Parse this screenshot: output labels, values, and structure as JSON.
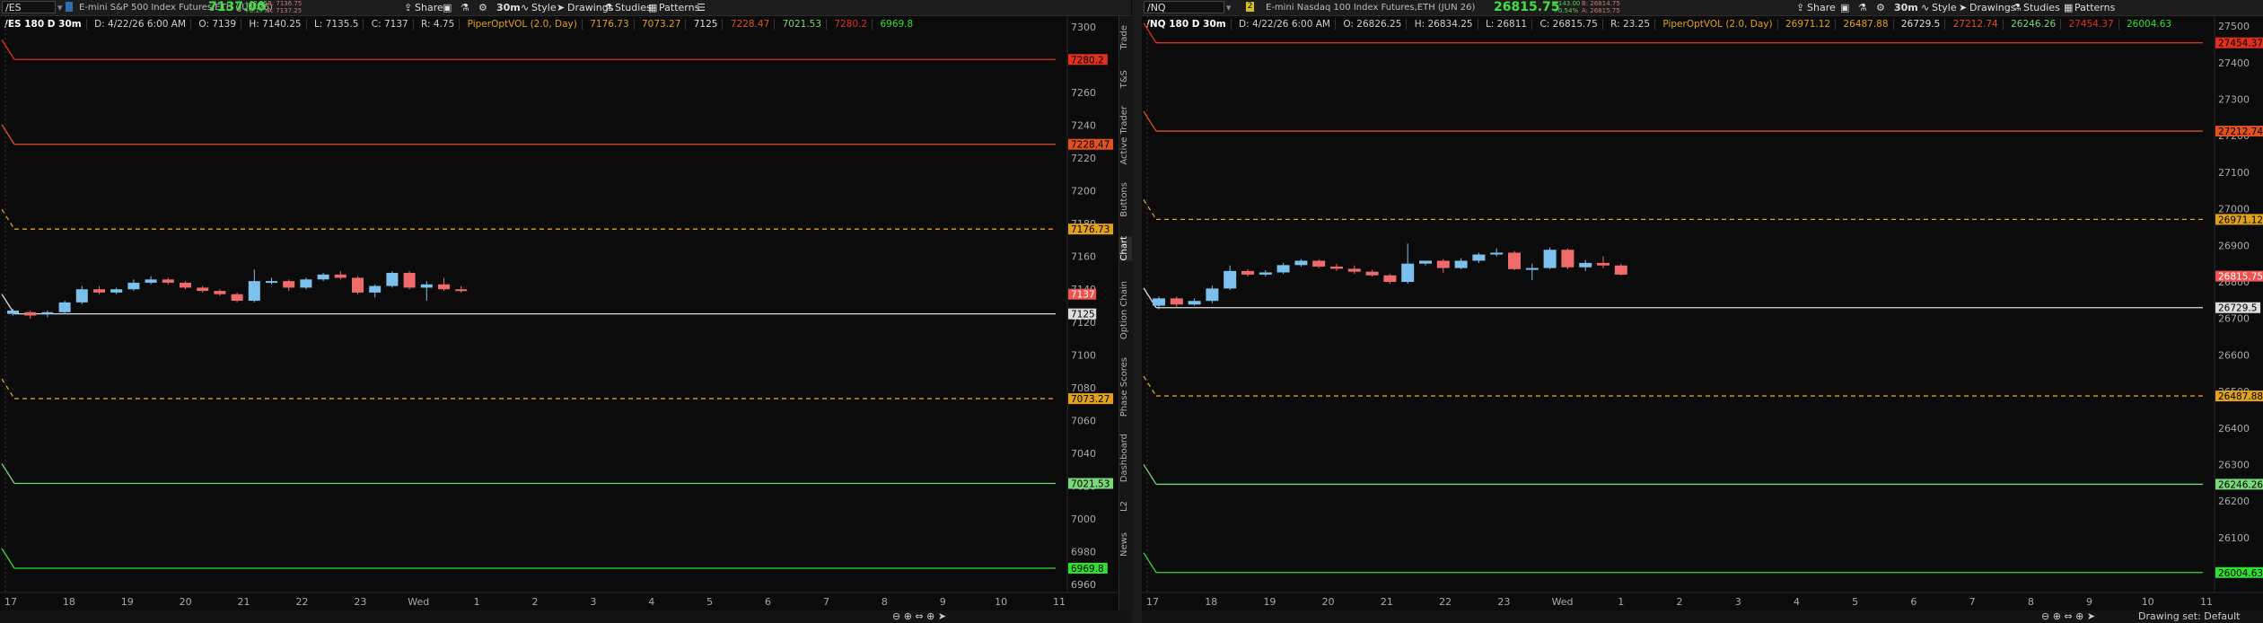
{
  "left": {
    "symbol": "/ES",
    "description": "E-mini S&P 500 Index Futures,ETH (JUN 26)",
    "last_price": "7137.00",
    "change": "+12.25",
    "change_pct": "+0.17%",
    "bid": "B: 7136.75",
    "ask": "A: 7137.25",
    "interval": "30m",
    "toolbar": {
      "share": "Share",
      "style": "Style",
      "drawings": "Drawings",
      "studies": "Studies",
      "patterns": "Patterns"
    },
    "info": {
      "title": "/ES 180 D 30m",
      "date": "D: 4/22/26 6:00 AM",
      "open": "O: 7139",
      "high": "H: 7140.25",
      "low": "L: 7135.5",
      "close": "C: 7137",
      "range": "R: 4.75",
      "study": "PiperOptVOL (2.0, Day)",
      "levels": [
        "7176.73",
        "7073.27",
        "7125",
        "7228.47",
        "7021.53",
        "7280.2",
        "6969.8"
      ]
    },
    "chart_data": {
      "type": "candlestick",
      "ylim": [
        6955,
        7305
      ],
      "y_ticks": [
        6960,
        6980,
        7000,
        7020,
        7040,
        7060,
        7080,
        7100,
        7120,
        7140,
        7160,
        7180,
        7200,
        7220,
        7240,
        7260,
        7280,
        7300
      ],
      "x_ticks": [
        "17",
        "18",
        "19",
        "20",
        "21",
        "22",
        "23",
        "Wed",
        "1",
        "2",
        "3",
        "4",
        "5",
        "6",
        "7",
        "8",
        "9",
        "10",
        "11"
      ],
      "candles": [
        {
          "o": 7125,
          "h": 7128,
          "c": 7127,
          "l": 7124
        },
        {
          "o": 7126,
          "h": 7127,
          "c": 7124,
          "l": 7122
        },
        {
          "o": 7125,
          "h": 7127,
          "c": 7126,
          "l": 7123
        },
        {
          "o": 7126,
          "h": 7133,
          "c": 7132,
          "l": 7125
        },
        {
          "o": 7132,
          "h": 7142,
          "c": 7140,
          "l": 7131
        },
        {
          "o": 7140,
          "h": 7142,
          "c": 7138,
          "l": 7137
        },
        {
          "o": 7138,
          "h": 7141,
          "c": 7140,
          "l": 7137
        },
        {
          "o": 7140,
          "h": 7146,
          "c": 7144,
          "l": 7139
        },
        {
          "o": 7144,
          "h": 7148,
          "c": 7146,
          "l": 7143
        },
        {
          "o": 7146,
          "h": 7147,
          "c": 7144,
          "l": 7143
        },
        {
          "o": 7144,
          "h": 7145,
          "c": 7141,
          "l": 7140
        },
        {
          "o": 7141,
          "h": 7142,
          "c": 7139,
          "l": 7138
        },
        {
          "o": 7139,
          "h": 7140,
          "c": 7137,
          "l": 7136
        },
        {
          "o": 7137,
          "h": 7138,
          "c": 7133,
          "l": 7132
        },
        {
          "o": 7133,
          "h": 7152,
          "c": 7145,
          "l": 7132
        },
        {
          "o": 7145,
          "h": 7147,
          "c": 7145,
          "l": 7143
        },
        {
          "o": 7145,
          "h": 7146,
          "c": 7141,
          "l": 7139
        },
        {
          "o": 7141,
          "h": 7147,
          "c": 7146,
          "l": 7140
        },
        {
          "o": 7146,
          "h": 7150,
          "c": 7149,
          "l": 7145
        },
        {
          "o": 7149,
          "h": 7151,
          "c": 7147,
          "l": 7146
        },
        {
          "o": 7147,
          "h": 7148,
          "c": 7138,
          "l": 7137
        },
        {
          "o": 7138,
          "h": 7143,
          "c": 7142,
          "l": 7135
        },
        {
          "o": 7142,
          "h": 7151,
          "c": 7150,
          "l": 7141
        },
        {
          "o": 7150,
          "h": 7151,
          "c": 7141,
          "l": 7140
        },
        {
          "o": 7141,
          "h": 7145,
          "c": 7143,
          "l": 7133
        },
        {
          "o": 7143,
          "h": 7147,
          "c": 7140,
          "l": 7139
        },
        {
          "o": 7140,
          "h": 7142,
          "c": 7139,
          "l": 7138
        }
      ],
      "levels": [
        {
          "value": 7280.2,
          "color": "#e03020",
          "label": "7280.2",
          "dash": false
        },
        {
          "value": 7228.47,
          "color": "#e05020",
          "label": "7228.47",
          "dash": false
        },
        {
          "value": 7176.73,
          "color": "#e0a020",
          "label": "7176.73",
          "dash": true
        },
        {
          "value": 7125,
          "color": "#dddddd",
          "label": "7125",
          "dash": false
        },
        {
          "value": 7073.27,
          "color": "#e0a020",
          "label": "7073.27",
          "dash": true
        },
        {
          "value": 7021.53,
          "color": "#7ad87a",
          "label": "7021.53",
          "dash": false
        },
        {
          "value": 6969.8,
          "color": "#30e030",
          "label": "6969.8",
          "dash": false
        }
      ],
      "price_tag": {
        "value": 7137,
        "label": "7137",
        "color": "#ef5350"
      }
    }
  },
  "right": {
    "symbol": "/NQ",
    "description": "E-mini Nasdaq 100 Index Futures,ETH (JUN 26)",
    "last_price": "26815.75",
    "change": "+143.00",
    "change_pct": "+0.54%",
    "bid": "B: 26814.75",
    "ask": "A: 26815.75",
    "interval": "30m",
    "toolbar": {
      "share": "Share",
      "style": "Style",
      "drawings": "Drawings",
      "studies": "Studies",
      "patterns": "Patterns"
    },
    "info": {
      "title": "/NQ 180 D 30m",
      "date": "D: 4/22/26 6:00 AM",
      "open": "O: 26826.25",
      "high": "H: 26834.25",
      "low": "L: 26811",
      "close": "C: 26815.75",
      "range": "R: 23.25",
      "study": "PiperOptVOL (2.0, Day)",
      "levels": [
        "26971.12",
        "26487.88",
        "26729.5",
        "27212.74",
        "26246.26",
        "27454.37",
        "26004.63"
      ]
    },
    "chart_data": {
      "type": "candlestick",
      "ylim": [
        25950,
        27520
      ],
      "y_ticks": [
        26000,
        26100,
        26200,
        26300,
        26400,
        26500,
        26600,
        26700,
        26800,
        26900,
        27000,
        27100,
        27200,
        27300,
        27400,
        27500
      ],
      "x_ticks": [
        "17",
        "18",
        "19",
        "20",
        "21",
        "22",
        "23",
        "Wed",
        "1",
        "2",
        "3",
        "4",
        "5",
        "6",
        "7",
        "8",
        "9",
        "10",
        "11"
      ],
      "candles": [
        {
          "o": 26735,
          "h": 26760,
          "c": 26755,
          "l": 26725
        },
        {
          "o": 26755,
          "h": 26760,
          "c": 26738,
          "l": 26730
        },
        {
          "o": 26738,
          "h": 26755,
          "c": 26748,
          "l": 26735
        },
        {
          "o": 26748,
          "h": 26790,
          "c": 26782,
          "l": 26742
        },
        {
          "o": 26782,
          "h": 26845,
          "c": 26830,
          "l": 26778
        },
        {
          "o": 26830,
          "h": 26835,
          "c": 26820,
          "l": 26815
        },
        {
          "o": 26820,
          "h": 26832,
          "c": 26826,
          "l": 26815
        },
        {
          "o": 26826,
          "h": 26852,
          "c": 26846,
          "l": 26822
        },
        {
          "o": 26846,
          "h": 26862,
          "c": 26858,
          "l": 26842
        },
        {
          "o": 26858,
          "h": 26862,
          "c": 26842,
          "l": 26838
        },
        {
          "o": 26842,
          "h": 26850,
          "c": 26836,
          "l": 26830
        },
        {
          "o": 26836,
          "h": 26845,
          "c": 26828,
          "l": 26822
        },
        {
          "o": 26828,
          "h": 26833,
          "c": 26818,
          "l": 26815
        },
        {
          "o": 26818,
          "h": 26822,
          "c": 26800,
          "l": 26795
        },
        {
          "o": 26800,
          "h": 26905,
          "c": 26850,
          "l": 26795
        },
        {
          "o": 26850,
          "h": 26858,
          "c": 26858,
          "l": 26845
        },
        {
          "o": 26858,
          "h": 26862,
          "c": 26838,
          "l": 26825
        },
        {
          "o": 26838,
          "h": 26865,
          "c": 26858,
          "l": 26835
        },
        {
          "o": 26858,
          "h": 26880,
          "c": 26875,
          "l": 26852
        },
        {
          "o": 26875,
          "h": 26892,
          "c": 26880,
          "l": 26870
        },
        {
          "o": 26880,
          "h": 26885,
          "c": 26835,
          "l": 26832
        },
        {
          "o": 26835,
          "h": 26850,
          "c": 26838,
          "l": 26805
        },
        {
          "o": 26838,
          "h": 26895,
          "c": 26888,
          "l": 26835
        },
        {
          "o": 26888,
          "h": 26892,
          "c": 26840,
          "l": 26835
        },
        {
          "o": 26840,
          "h": 26860,
          "c": 26852,
          "l": 26830
        },
        {
          "o": 26852,
          "h": 26870,
          "c": 26845,
          "l": 26838
        },
        {
          "o": 26845,
          "h": 26850,
          "c": 26820,
          "l": 26818
        }
      ],
      "levels": [
        {
          "value": 27454.37,
          "color": "#e03020",
          "label": "27454.37",
          "dash": false
        },
        {
          "value": 27212.74,
          "color": "#e05020",
          "label": "27212.74",
          "dash": false
        },
        {
          "value": 26971.12,
          "color": "#e0a020",
          "label": "26971.12",
          "dash": true
        },
        {
          "value": 26729.5,
          "color": "#dddddd",
          "label": "26729.5",
          "dash": false
        },
        {
          "value": 26487.88,
          "color": "#e0a020",
          "label": "26487.88",
          "dash": true
        },
        {
          "value": 26246.26,
          "color": "#7ad87a",
          "label": "26246.26",
          "dash": false
        },
        {
          "value": 26004.63,
          "color": "#30e030",
          "label": "26004.63",
          "dash": false
        }
      ],
      "price_tag": {
        "value": 26815.75,
        "label": "26815.75",
        "color": "#ef5350"
      }
    }
  },
  "sidebar_tabs": [
    "Trade",
    "T&S",
    "Active Trader",
    "Buttons",
    "Chart",
    "Option Chain",
    "Phase Scores",
    "Dashboard",
    "L2",
    "News"
  ],
  "footer": {
    "drawing_set": "Drawing set: Default"
  }
}
